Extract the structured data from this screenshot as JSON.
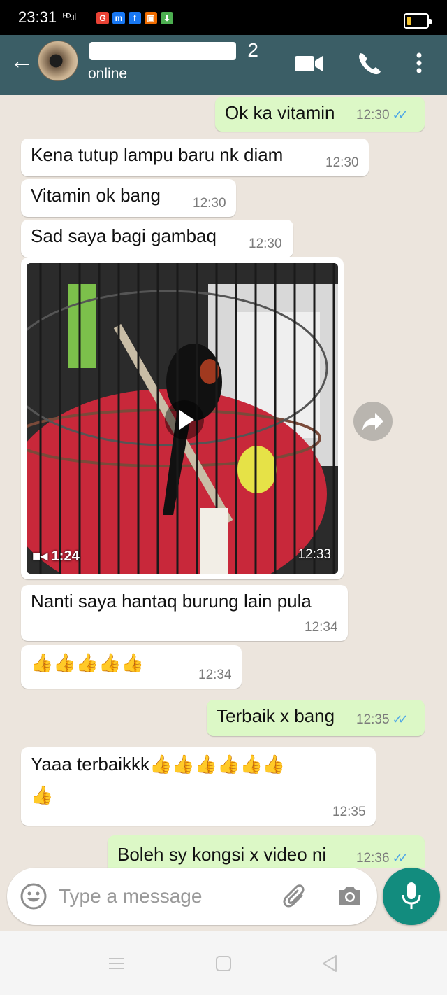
{
  "status_bar": {
    "time": "23:31",
    "signal": "ᴴᴰ.ıl",
    "apps": [
      "G",
      "m",
      "f",
      "▣",
      "⬇"
    ],
    "app_colors": [
      "#e94235",
      "#1877f2",
      "#1877f2",
      "#ef6c00",
      "#4caf50"
    ]
  },
  "header": {
    "back_icon": "arrow-back-icon",
    "contact_name_visible": "2",
    "contact_status": "online",
    "icons": [
      "video-call-icon",
      "voice-call-icon",
      "more-vert-icon"
    ]
  },
  "messages": [
    {
      "dir": "out",
      "text": "Ok ka vitamin",
      "time": "12:30",
      "ticks": "read"
    },
    {
      "dir": "in",
      "text": "Kena tutup lampu baru nk diam",
      "time": "12:30"
    },
    {
      "dir": "in",
      "text": "Vitamin ok bang",
      "time": "12:30"
    },
    {
      "dir": "in",
      "text": "Sad saya bagi gambaq",
      "time": "12:30"
    },
    {
      "dir": "in",
      "type": "video",
      "duration": "1:24",
      "time": "12:33"
    },
    {
      "dir": "in",
      "text": "Nanti saya hantaq burung lain pula",
      "time": "12:34"
    },
    {
      "dir": "in",
      "text": "👍👍👍👍👍",
      "time": "12:34"
    },
    {
      "dir": "out",
      "text": "Terbaik x bang",
      "time": "12:35",
      "ticks": "read"
    },
    {
      "dir": "in",
      "text": "Yaaa terbaikkk👍👍👍👍👍👍\n👍",
      "time": "12:35"
    },
    {
      "dir": "out",
      "text": "Boleh sy kongsi x video ni",
      "time": "12:36",
      "ticks": "read"
    }
  ],
  "input": {
    "placeholder": "Type a message",
    "icons": [
      "emoji-icon",
      "attach-icon",
      "camera-icon",
      "mic-icon"
    ]
  },
  "colors": {
    "header": "#3b5e66",
    "chat_bg": "#ece5dd",
    "outgoing": "#dcf8c6",
    "incoming": "#ffffff",
    "mic_button": "#128c7e",
    "tick_read": "#4fa7e6"
  }
}
